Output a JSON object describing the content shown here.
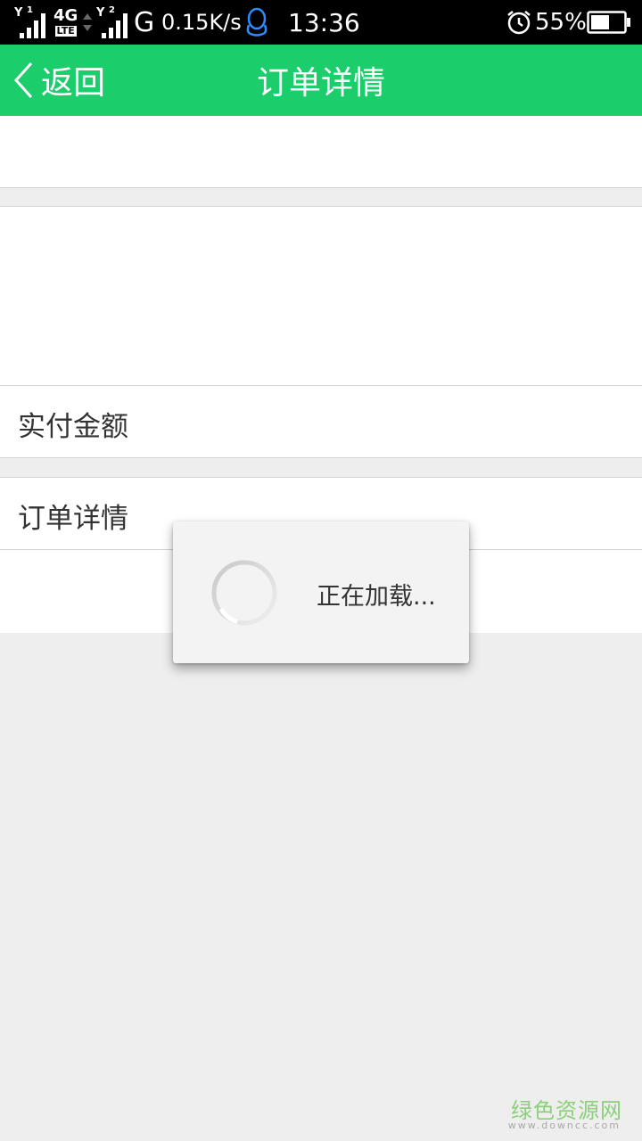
{
  "status_bar": {
    "sim1_label": "1",
    "network_4g": "4G",
    "network_lte": "LTE",
    "sim2_label": "2",
    "network_g": "G",
    "speed": "0.15K/s",
    "time": "13:36",
    "battery": "55%",
    "battery_level": 0.55,
    "icons": [
      "signal-icon",
      "signal-icon",
      "qq-icon",
      "alarm-icon",
      "battery-icon"
    ]
  },
  "header": {
    "back_label": "返回",
    "title": "订单详情",
    "color": "#1ccd6c"
  },
  "content": {
    "paid_amount_label": "实付金额",
    "order_detail_label": "订单详情"
  },
  "dialog": {
    "loading_text": "正在加载..."
  },
  "watermark": {
    "name": "绿色资源网",
    "url": "www.downcc.com"
  }
}
